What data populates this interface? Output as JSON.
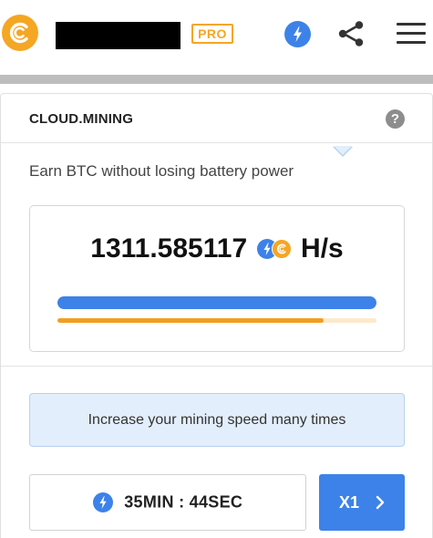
{
  "header": {
    "pro_badge": "PRO",
    "icons": {
      "logo": "cryptotab-logo-icon",
      "boost": "lightning-icon",
      "share": "share-icon",
      "menu": "hamburger-menu-icon"
    }
  },
  "card": {
    "title": "CLOUD.MINING",
    "help": "?",
    "subtitle": "Earn BTC without losing battery power",
    "rate": {
      "value": "1311.585117",
      "unit": "H/s"
    },
    "progress": {
      "blue_fraction": 1.0,
      "orange_fraction": 0.834
    },
    "tip": "Increase your mining speed many times",
    "timer": "35MIN : 44SEC",
    "multiplier": "X1"
  },
  "colors": {
    "brand_orange": "#f5a623",
    "accent_blue": "#3d82e8",
    "tip_bg": "#e3eefc",
    "divider_gray": "#bdbdbd"
  }
}
